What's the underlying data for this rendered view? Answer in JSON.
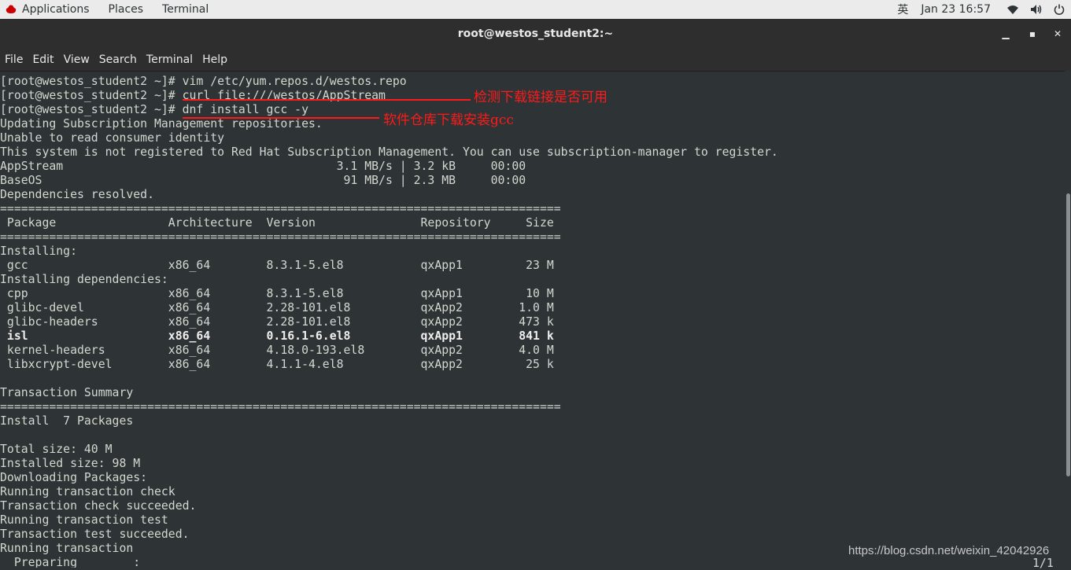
{
  "topbar": {
    "applications": "Applications",
    "places": "Places",
    "terminal": "Terminal",
    "input_method": "英",
    "datetime": "Jan 23  16:57"
  },
  "window": {
    "title": "root@westos_student2:~",
    "minimize": "▁",
    "maximize": "▪",
    "close": "✕"
  },
  "menu": [
    "File",
    "Edit",
    "View",
    "Search",
    "Terminal",
    "Help"
  ],
  "terminal_lines": [
    "[root@westos_student2 ~]# vim /etc/yum.repos.d/westos.repo",
    "[root@westos_student2 ~]# curl file:///westos/AppStream",
    "[root@westos_student2 ~]# dnf install gcc -y",
    "Updating Subscription Management repositories.",
    "Unable to read consumer identity",
    "This system is not registered to Red Hat Subscription Management. You can use subscription-manager to register.",
    "AppStream                                       3.1 MB/s | 3.2 kB     00:00",
    "BaseOS                                           91 MB/s | 2.3 MB     00:00",
    "Dependencies resolved.",
    "================================================================================",
    " Package                Architecture  Version               Repository     Size",
    "================================================================================",
    "Installing:",
    " gcc                    x86_64        8.3.1-5.el8           qxApp1         23 M",
    "Installing dependencies:",
    " cpp                    x86_64        8.3.1-5.el8           qxApp1         10 M",
    " glibc-devel            x86_64        2.28-101.el8          qxApp2        1.0 M",
    " glibc-headers          x86_64        2.28-101.el8          qxApp2        473 k",
    " isl                    x86_64        0.16.1-6.el8          qxApp1        841 k",
    " kernel-headers         x86_64        4.18.0-193.el8        qxApp2        4.0 M",
    " libxcrypt-devel        x86_64        4.1.1-4.el8           qxApp2         25 k",
    "",
    "Transaction Summary",
    "================================================================================",
    "Install  7 Packages",
    "",
    "Total size: 40 M",
    "Installed size: 98 M",
    "Downloading Packages:",
    "Running transaction check",
    "Transaction check succeeded.",
    "Running transaction test",
    "Transaction test succeeded.",
    "Running transaction",
    "  Preparing        :"
  ],
  "bold_line_index": 18,
  "annotations": {
    "curl_note": "检测下载链接是否可用",
    "dnf_note": "软件仓库下载安装gcc"
  },
  "progress_text": "1/1",
  "watermark": "https://blog.csdn.net/weixin_42042926",
  "colors": {
    "terminal_bg": "#2e3436",
    "terminal_fg": "#d3d7cf",
    "annotation": "#ff1a1a",
    "topbar_bg": "#ebebeb",
    "titlebar_bg": "#2e2e2e"
  }
}
